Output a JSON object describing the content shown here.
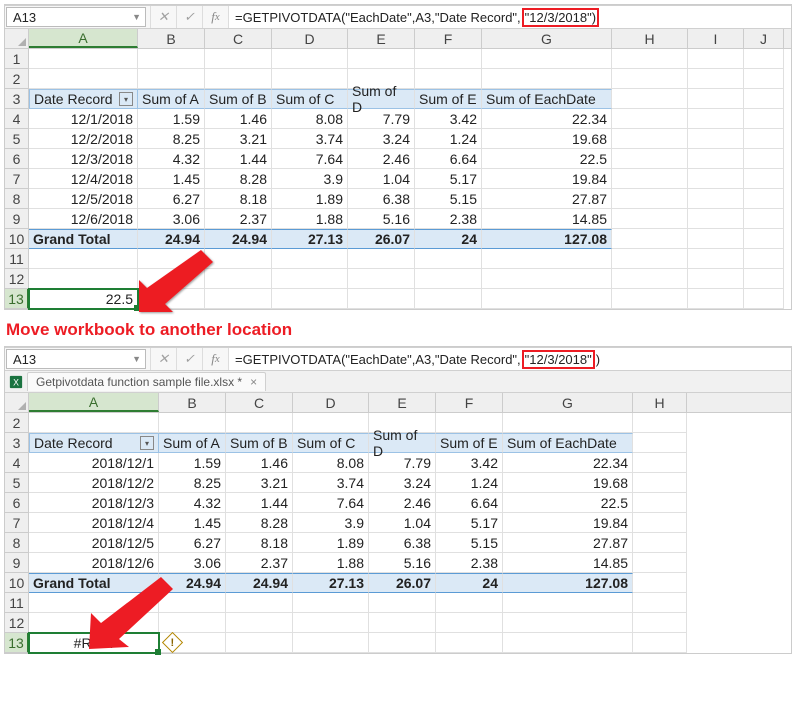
{
  "shot1": {
    "cell_ref": "A13",
    "formula_prefix": "=GETPIVOTDATA(\"EachDate\",A3,\"Date Record\",",
    "formula_hl": "\"12/3/2018\")",
    "formula_suffix": "",
    "cols": [
      "A",
      "B",
      "C",
      "D",
      "E",
      "F",
      "G",
      "H",
      "I",
      "J"
    ],
    "rows": [
      "1",
      "2",
      "3",
      "4",
      "5",
      "6",
      "7",
      "8",
      "9",
      "10",
      "11",
      "12",
      "13"
    ],
    "pivot": {
      "corner": "Date Record",
      "headers": [
        "Sum of A",
        "Sum of B",
        "Sum of C",
        "Sum of D",
        "Sum of E",
        "Sum of EachDate"
      ],
      "data": [
        {
          "d": "12/1/2018",
          "v": [
            "1.59",
            "1.46",
            "8.08",
            "7.79",
            "3.42",
            "22.34"
          ]
        },
        {
          "d": "12/2/2018",
          "v": [
            "8.25",
            "3.21",
            "3.74",
            "3.24",
            "1.24",
            "19.68"
          ]
        },
        {
          "d": "12/3/2018",
          "v": [
            "4.32",
            "1.44",
            "7.64",
            "2.46",
            "6.64",
            "22.5"
          ]
        },
        {
          "d": "12/4/2018",
          "v": [
            "1.45",
            "8.28",
            "3.9",
            "1.04",
            "5.17",
            "19.84"
          ]
        },
        {
          "d": "12/5/2018",
          "v": [
            "6.27",
            "8.18",
            "1.89",
            "6.38",
            "5.15",
            "27.87"
          ]
        },
        {
          "d": "12/6/2018",
          "v": [
            "3.06",
            "2.37",
            "1.88",
            "5.16",
            "2.38",
            "14.85"
          ]
        }
      ],
      "grand": {
        "label": "Grand Total",
        "v": [
          "24.94",
          "24.94",
          "27.13",
          "26.07",
          "24",
          "127.08"
        ]
      }
    },
    "sel_value": "22.5"
  },
  "caption": "Move workbook to another location",
  "shot2": {
    "cell_ref": "A13",
    "formula_prefix": "=GETPIVOTDATA(\"EachDate\",A3,\"Date Record\",",
    "formula_hl": "\"12/3/2018\"",
    "formula_suffix": ")",
    "tab": "Getpivotdata function sample file.xlsx *",
    "cols": [
      "A",
      "B",
      "C",
      "D",
      "E",
      "F",
      "G",
      "H"
    ],
    "rows": [
      "2",
      "3",
      "4",
      "5",
      "6",
      "7",
      "8",
      "9",
      "10",
      "11",
      "12",
      "13"
    ],
    "pivot": {
      "corner": "Date Record",
      "headers": [
        "Sum of A",
        "Sum of B",
        "Sum of C",
        "Sum of D",
        "Sum of E",
        "Sum of EachDate"
      ],
      "data": [
        {
          "d": "2018/12/1",
          "v": [
            "1.59",
            "1.46",
            "8.08",
            "7.79",
            "3.42",
            "22.34"
          ]
        },
        {
          "d": "2018/12/2",
          "v": [
            "8.25",
            "3.21",
            "3.74",
            "3.24",
            "1.24",
            "19.68"
          ]
        },
        {
          "d": "2018/12/3",
          "v": [
            "4.32",
            "1.44",
            "7.64",
            "2.46",
            "6.64",
            "22.5"
          ]
        },
        {
          "d": "2018/12/4",
          "v": [
            "1.45",
            "8.28",
            "3.9",
            "1.04",
            "5.17",
            "19.84"
          ]
        },
        {
          "d": "2018/12/5",
          "v": [
            "6.27",
            "8.18",
            "1.89",
            "6.38",
            "5.15",
            "27.87"
          ]
        },
        {
          "d": "2018/12/6",
          "v": [
            "3.06",
            "2.37",
            "1.88",
            "5.16",
            "2.38",
            "14.85"
          ]
        }
      ],
      "grand": {
        "label": "Grand Total",
        "v": [
          "24.94",
          "24.94",
          "27.13",
          "26.07",
          "24",
          "127.08"
        ]
      }
    },
    "sel_value": "#REF!"
  }
}
